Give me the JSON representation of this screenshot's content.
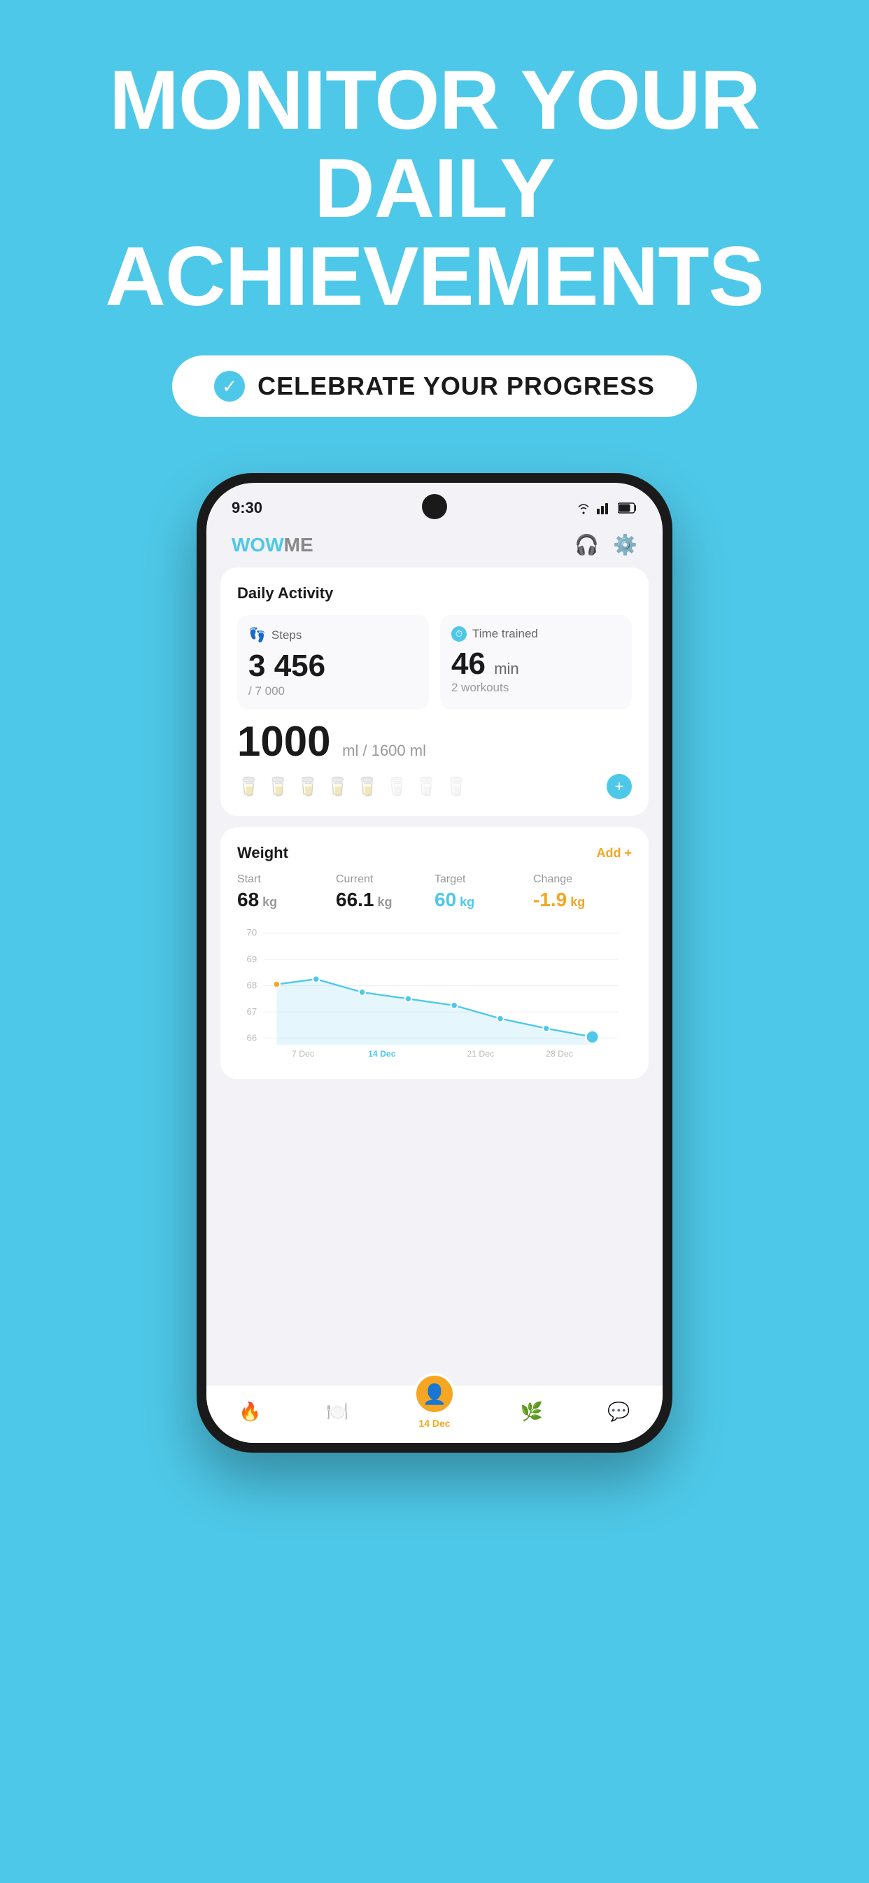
{
  "hero": {
    "line1": "MONITOR YOUR",
    "line2": "DAILY",
    "line3": "ACHIEVEMENTS",
    "badge_text": "CELEBRATE YOUR PROGRESS"
  },
  "status_bar": {
    "time": "9:30"
  },
  "app": {
    "logo_wow": "WOW",
    "logo_me": "ME"
  },
  "header_icons": {
    "support": "🎧",
    "settings": "⚙️"
  },
  "daily_activity": {
    "title": "Daily Activity",
    "steps_label": "Steps",
    "steps_value": "3 456",
    "steps_goal": "/ 7 000",
    "time_label": "Time trained",
    "time_value": "46",
    "time_unit": "min",
    "workouts": "2 workouts"
  },
  "water": {
    "value": "1000",
    "unit": "ml",
    "separator": " / ",
    "goal": "1600 ml",
    "filled_glasses": 5,
    "total_glasses": 8
  },
  "weight": {
    "title": "Weight",
    "add_label": "Add +",
    "start_label": "Start",
    "start_value": "68",
    "start_unit": " kg",
    "current_label": "Current",
    "current_value": "66.1",
    "current_bold": "66.",
    "current_decimal": "1",
    "current_unit": " kg",
    "target_label": "Target",
    "target_value": "60",
    "target_unit": " kg",
    "change_label": "Change",
    "change_value": "-1.9",
    "change_unit": " kg"
  },
  "chart": {
    "y_labels": [
      "70",
      "69",
      "68",
      "67",
      "66"
    ],
    "x_labels": [
      "7 Dec",
      "14 Dec",
      "21 Dec",
      "28 Dec"
    ]
  },
  "bottom_nav": {
    "items": [
      {
        "icon": "🔥",
        "label": "",
        "active": false
      },
      {
        "icon": "🍽️",
        "label": "",
        "active": false
      },
      {
        "icon": "👤",
        "label": "14 Dec",
        "active": true,
        "center": true
      },
      {
        "icon": "🌿",
        "label": "",
        "active": false
      },
      {
        "icon": "💬",
        "label": "",
        "active": false
      }
    ]
  }
}
